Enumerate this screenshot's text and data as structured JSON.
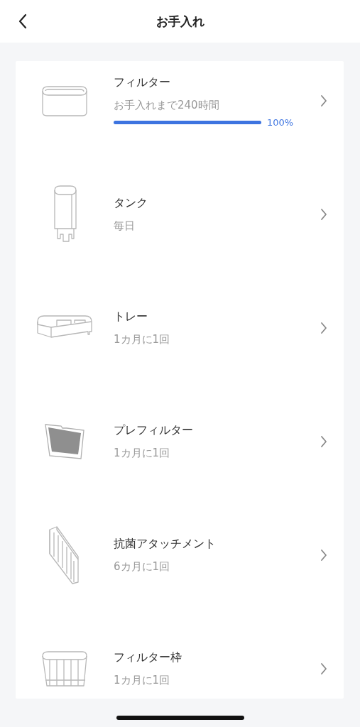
{
  "header": {
    "title": "お手入れ"
  },
  "items": [
    {
      "kind": "progress",
      "title": "フィルター",
      "subtitle": "お手入れまで240時間",
      "level": 1.0,
      "reading": "100%"
    },
    {
      "kind": "plain",
      "title": "タンク",
      "subtitle": "毎日"
    },
    {
      "kind": "plain",
      "title": "トレー",
      "subtitle": "1カ月に1回"
    },
    {
      "kind": "plain",
      "title": "プレフィルター",
      "subtitle": "1カ月に1回"
    },
    {
      "kind": "plain",
      "title": "抗菌アタッチメント",
      "subtitle": "6カ月に1回"
    },
    {
      "kind": "plain",
      "title": "フィルター枠",
      "subtitle": "1カ月に1回"
    }
  ]
}
